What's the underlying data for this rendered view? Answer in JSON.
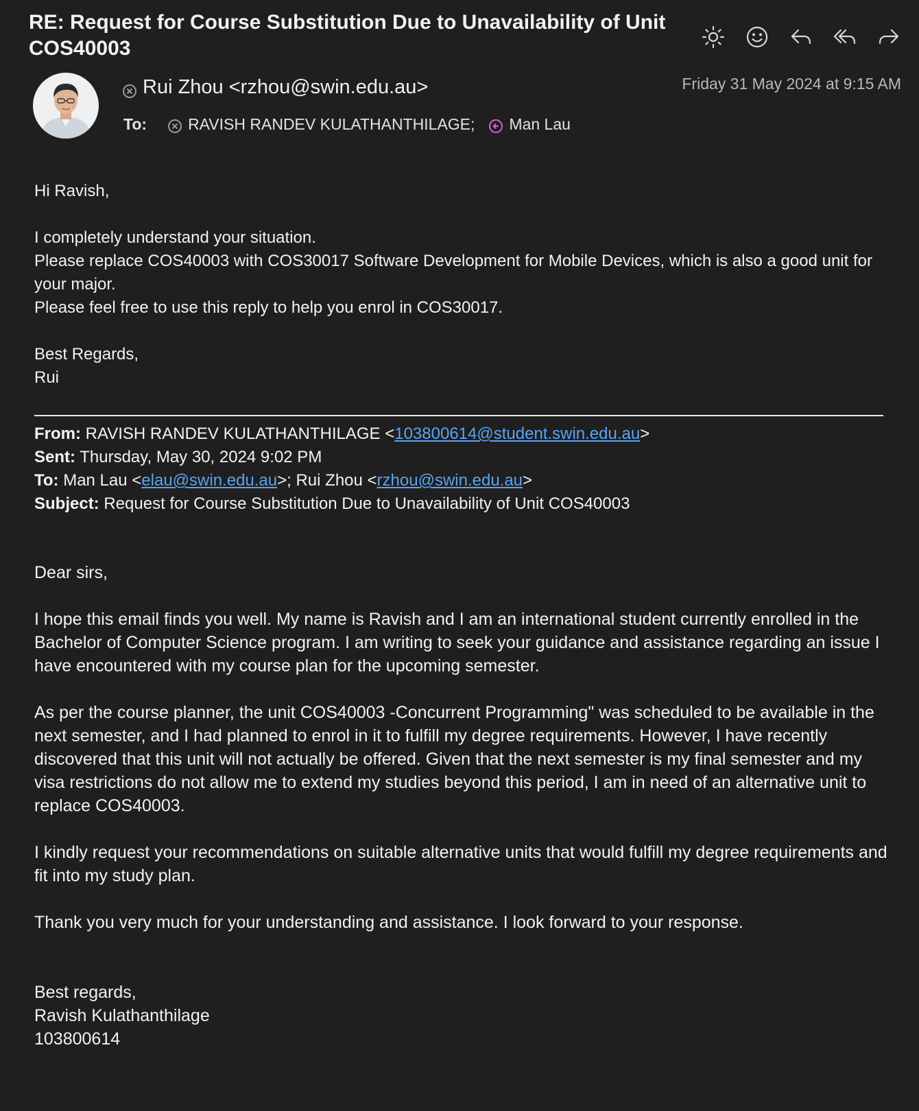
{
  "subject": "RE: Request for Course Substitution Due to Unavailability of Unit COS40003",
  "actions": [
    "brightness",
    "emoji",
    "reply",
    "reply-all",
    "forward"
  ],
  "sender": {
    "display": "Rui Zhou <rzhou@swin.edu.au>"
  },
  "datetime": "Friday 31 May 2024 at 9:15 AM",
  "to": {
    "label": "To:",
    "recipients": [
      "RAVISH RANDEV KULATHANTHILAGE;",
      "Man Lau"
    ]
  },
  "reply": {
    "greeting": "Hi Ravish,",
    "lines": [
      "I completely understand your situation.",
      "Please replace COS40003 with COS30017 Software Development for Mobile Devices, which is also a good unit for your major.",
      "Please feel free to use this reply to help you enrol in COS30017."
    ],
    "signoff": "Best Regards,",
    "name": "Rui"
  },
  "quoted": {
    "from_label": "From:",
    "from_name": "RAVISH RANDEV KULATHANTHILAGE <",
    "from_email": "103800614@student.swin.edu.au",
    "from_close": ">",
    "sent_label": "Sent:",
    "sent_value": "Thursday, May 30, 2024 9:02 PM",
    "to_label": "To:",
    "to_name1": "Man Lau <",
    "to_email1": "elau@swin.edu.au",
    "to_sep": ">; Rui Zhou <",
    "to_email2": "rzhou@swin.edu.au",
    "to_close": ">",
    "subject_label": "Subject:",
    "subject_value": "Request for Course Substitution Due to Unavailability of Unit COS40003"
  },
  "original": {
    "greeting": "Dear sirs,",
    "p1": "I hope this email finds you well. My name is Ravish and I am an international student currently enrolled in the Bachelor of Computer Science program. I am writing to seek your guidance and assistance regarding an issue I have encountered with my course plan for the upcoming semester.",
    "p2": "As per the course planner, the unit COS40003 -Concurrent Programming\" was scheduled to be available in the next semester, and I had planned to enrol in it to fulfill my degree requirements. However, I have recently discovered that this unit will not actually be offered. Given that the next semester is my final semester and my visa restrictions do not allow me to extend my studies beyond this period, I am in need of an alternative unit to replace COS40003.",
    "p3": "I kindly request your recommendations on suitable alternative units that would fulfill my degree requirements and fit into my study plan.",
    "p4": "Thank you very much for your understanding and assistance. I look forward to your response.",
    "signoff": "Best regards,",
    "name": "Ravish Kulathanthilage",
    "id": "103800614"
  }
}
